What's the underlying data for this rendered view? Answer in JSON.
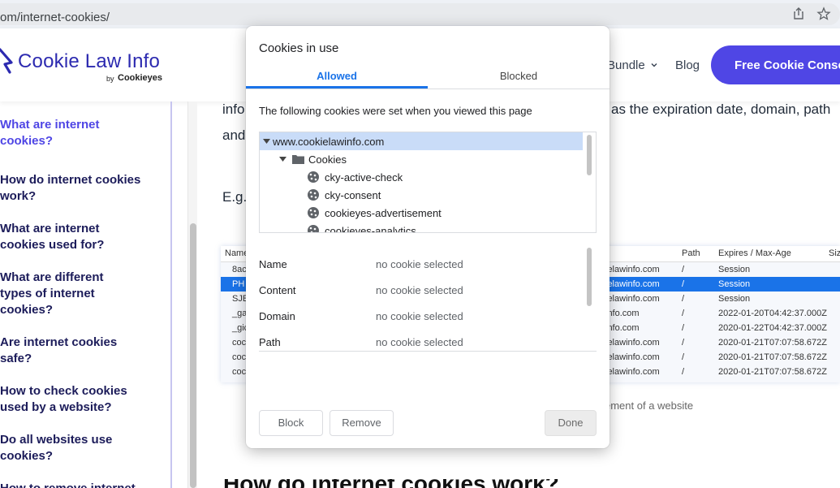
{
  "browser": {
    "url": "om/internet-cookies/",
    "share_icon": "share-icon",
    "bookmark_icon": "star-icon"
  },
  "site": {
    "logo_text": "Cookie Law Info",
    "logo_by": "by",
    "logo_brand": "Cookieyes",
    "nav": {
      "bundle": "Bundle",
      "blog": "Blog"
    },
    "cta": "Free Cookie Consent",
    "accent_color": "#4f46e5"
  },
  "toc": {
    "items": [
      {
        "lines": [
          "What are internet",
          "cookies?"
        ],
        "active": true
      },
      {
        "lines": [
          "How do internet cookies",
          "work?"
        ],
        "active": false
      },
      {
        "lines": [
          "What are internet",
          "cookies used for?"
        ],
        "active": false
      },
      {
        "lines": [
          "What are different",
          "types of internet",
          "cookies?"
        ],
        "active": false
      },
      {
        "lines": [
          "Are internet cookies",
          "safe?"
        ],
        "active": false
      },
      {
        "lines": [
          "How to check cookies",
          "used by a website?"
        ],
        "active": false
      },
      {
        "lines": [
          "Do all websites use",
          "cookies?"
        ],
        "active": false
      },
      {
        "lines": [
          "How to remove internet"
        ],
        "active": false
      }
    ]
  },
  "article": {
    "line1_left": "info",
    "line1_right": "as the expiration date, domain, path",
    "line2_left": "and",
    "eg": "E.g.",
    "caption": "ement of a website",
    "heading_fragment": "How do internet cookies work?"
  },
  "cookie_table": {
    "headers": {
      "name": "Name",
      "path": "Path",
      "expires": "Expires / Max-Age",
      "size": "Size"
    },
    "rows": [
      {
        "name": "8ac",
        "domain": "ielawinfo.com",
        "path": "/",
        "expires": "Session",
        "selected": false
      },
      {
        "name": "PH",
        "domain": "ielawinfo.com",
        "path": "/",
        "expires": "Session",
        "selected": true
      },
      {
        "name": "SJE",
        "domain": "ielawinfo.com",
        "path": "/",
        "expires": "Session",
        "selected": false
      },
      {
        "name": "_ga",
        "domain": "info.com",
        "path": "/",
        "expires": "2022-01-20T04:42:37.000Z",
        "selected": false
      },
      {
        "name": "_gic",
        "domain": "info.com",
        "path": "/",
        "expires": "2020-01-22T04:42:37.000Z",
        "selected": false
      },
      {
        "name": "coc",
        "domain": "ielawinfo.com",
        "path": "/",
        "expires": "2020-01-21T07:07:58.672Z",
        "selected": false
      },
      {
        "name": "coc",
        "domain": "ielawinfo.com",
        "path": "/",
        "expires": "2020-01-21T07:07:58.672Z",
        "selected": false
      },
      {
        "name": "coc",
        "domain": "ielawinfo.com",
        "path": "/",
        "expires": "2020-01-21T07:07:58.672Z",
        "selected": false
      }
    ]
  },
  "dialog": {
    "title": "Cookies in use",
    "tabs": {
      "allowed": "Allowed",
      "blocked": "Blocked"
    },
    "description": "The following cookies were set when you viewed this page",
    "tree": {
      "domain": "www.cookielawinfo.com",
      "folder": "Cookies",
      "cookies": [
        "cky-active-check",
        "cky-consent",
        "cookieyes-advertisement",
        "cookieyes-analytics"
      ]
    },
    "details": [
      {
        "key": "Name",
        "value": "no cookie selected"
      },
      {
        "key": "Content",
        "value": "no cookie selected"
      },
      {
        "key": "Domain",
        "value": "no cookie selected"
      },
      {
        "key": "Path",
        "value": "no cookie selected"
      }
    ],
    "buttons": {
      "block": "Block",
      "remove": "Remove",
      "done": "Done"
    }
  }
}
